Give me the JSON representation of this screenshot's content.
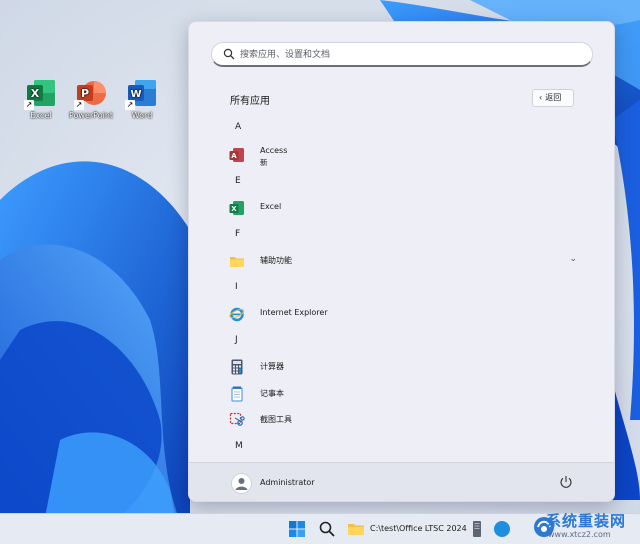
{
  "desktop": {
    "icons": [
      {
        "label": "Excel"
      },
      {
        "label": "PowerPoint"
      },
      {
        "label": "Word"
      }
    ]
  },
  "start_menu": {
    "search": {
      "placeholder": "搜索应用、设置和文档"
    },
    "title": "所有应用",
    "back_label": "返回",
    "groups": [
      {
        "letter": "A"
      },
      {
        "letter": "E"
      },
      {
        "letter": "F"
      },
      {
        "letter": "I"
      },
      {
        "letter": "J"
      },
      {
        "letter": "M"
      }
    ],
    "apps": [
      {
        "name": "Access",
        "sub": "新",
        "icon": "access-icon"
      },
      {
        "name": "Excel",
        "icon": "excel-icon"
      },
      {
        "name": "辅助功能",
        "icon": "folder-icon"
      },
      {
        "name": "Internet Explorer",
        "icon": "ie-icon"
      },
      {
        "name": "计算器",
        "icon": "calculator-icon"
      },
      {
        "name": "记事本",
        "icon": "notepad-icon"
      },
      {
        "name": "截图工具",
        "icon": "snipping-tool-icon"
      }
    ],
    "user": "Administrator"
  },
  "taskbar": {
    "explorer_path": "C:\\test\\Office LTSC 2024"
  },
  "watermark": {
    "title": "系统重装网",
    "url": "www.xtcz2.com"
  },
  "colors": {
    "accent": "#0067c0",
    "wallpaper_blue": "#1a6ce0"
  }
}
